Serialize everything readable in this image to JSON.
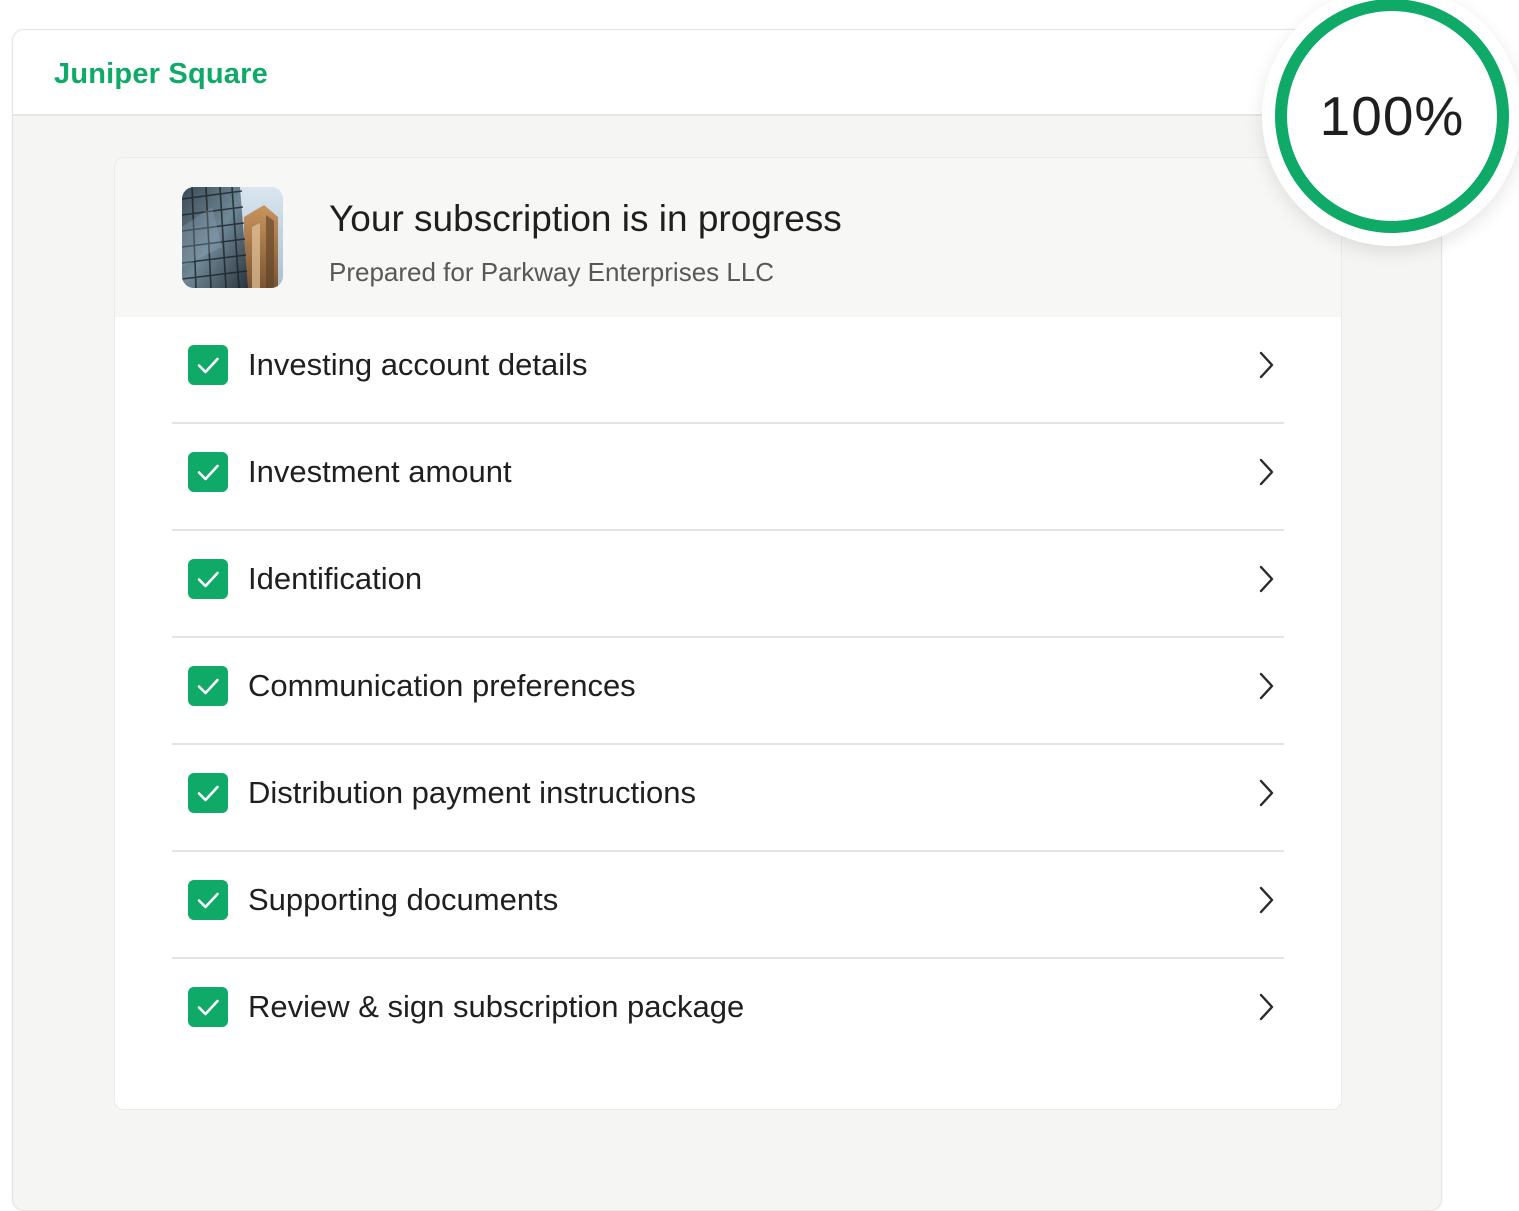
{
  "brand": {
    "name": "Juniper Square",
    "color": "#0fa968"
  },
  "progress": {
    "label": "100%",
    "value": 1.0
  },
  "subscription": {
    "title": "Your subscription is in progress",
    "subtitle": "Prepared for Parkway Enterprises LLC",
    "image": "building-photo"
  },
  "steps": [
    {
      "label": "Investing account details",
      "completed": true
    },
    {
      "label": "Investment amount",
      "completed": true
    },
    {
      "label": "Identification",
      "completed": true
    },
    {
      "label": "Communication preferences",
      "completed": true
    },
    {
      "label": "Distribution payment instructions",
      "completed": true
    },
    {
      "label": "Supporting documents",
      "completed": true
    },
    {
      "label": "Review & sign subscription package",
      "completed": true
    }
  ],
  "icons": {
    "step_status": "check-icon",
    "step_action": "chevron-right-icon"
  },
  "colors": {
    "accent": "#0fa968",
    "background": "#f5f5f3",
    "text": "#1f1f1f"
  }
}
